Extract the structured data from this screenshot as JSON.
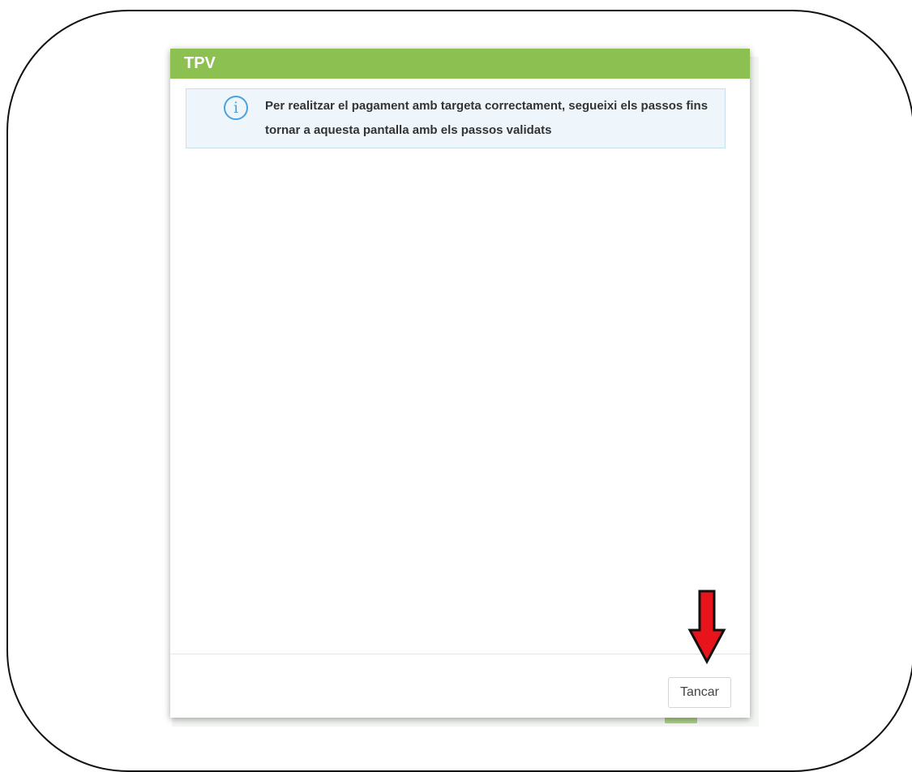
{
  "modal": {
    "title": "TPV",
    "info": {
      "icon": "info-icon",
      "text": "Per realitzar el pagament amb targeta correctament, segueixi els passos fins tornar a aquesta pantalla amb els passos validats"
    },
    "close_label": "Tancar"
  },
  "annotation": {
    "icon": "arrow-down-icon",
    "color": "#e8141b"
  },
  "colors": {
    "header": "#8cc152",
    "info_background": "#eef6fc",
    "info_icon": "#4aa3df"
  }
}
